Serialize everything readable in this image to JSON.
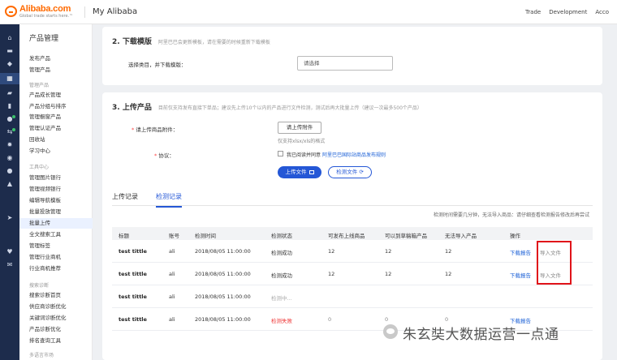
{
  "header": {
    "logo_text": "Alibaba.com",
    "logo_tagline": "Global trade starts here.™",
    "app_title": "My Alibaba",
    "links": [
      "Trade",
      "Development",
      "Acco"
    ]
  },
  "rail": {
    "icons": [
      "home-icon",
      "store-icon",
      "shield-icon",
      "grid-icon",
      "message-icon",
      "chart-icon",
      "users-icon",
      "transfer-icon",
      "gear-icon",
      "target-icon",
      "chat-icon",
      "bank-icon",
      "send-icon",
      "heart-icon",
      "mail-icon"
    ],
    "active_index": 3
  },
  "menu": {
    "title": "产品管理",
    "items": [
      {
        "label": "发布产品",
        "type": "item"
      },
      {
        "label": "管理产品",
        "type": "item"
      },
      {
        "label": "管理产品",
        "type": "group"
      },
      {
        "label": "产品成长管理",
        "type": "item"
      },
      {
        "label": "产品分组与排序",
        "type": "item"
      },
      {
        "label": "管理橱窗产品",
        "type": "item"
      },
      {
        "label": "管理认证产品",
        "type": "item"
      },
      {
        "label": "回收站",
        "type": "item"
      },
      {
        "label": "学习中心",
        "type": "item"
      },
      {
        "label": "工具中心",
        "type": "group"
      },
      {
        "label": "管理图片银行",
        "type": "item"
      },
      {
        "label": "管理视频银行",
        "type": "item"
      },
      {
        "label": "编辑导航模板",
        "type": "item"
      },
      {
        "label": "批量投放管理",
        "type": "item"
      },
      {
        "label": "批量上传",
        "type": "item",
        "active": true
      },
      {
        "label": "全文搜索工具",
        "type": "item"
      },
      {
        "label": "管理标签",
        "type": "item"
      },
      {
        "label": "管理行业商机",
        "type": "item"
      },
      {
        "label": "行业商机推荐",
        "type": "item"
      },
      {
        "label": "搜索诊断",
        "type": "group"
      },
      {
        "label": "搜索诊断首页",
        "type": "item"
      },
      {
        "label": "供应商诊断优化",
        "type": "item"
      },
      {
        "label": "关键词诊断优化",
        "type": "item"
      },
      {
        "label": "产品诊断优化",
        "type": "item"
      },
      {
        "label": "排名查询工具",
        "type": "item"
      },
      {
        "label": "多语言市场",
        "type": "group"
      }
    ]
  },
  "download": {
    "title": "2. 下载模版",
    "hint": "阿里巴巴会更新模板，请在需要的时候重新下载模板",
    "select_label": "选择类目，并下载模版：",
    "select_value": "请选择"
  },
  "upload": {
    "title": "3. 上传产品",
    "hint": "目前仅支持发布直接下单品；建议先上传10个以内的产品进行文件检测，测试后再大批量上传（建议一次最多500个产品）",
    "attach_label": "请上传商品附件：",
    "attach_button": "请上传附件",
    "attach_note": "仅支持xlsx/xls的格式",
    "agree_label": "协议：",
    "agree_text": "我已阅读并同意",
    "agree_link": "阿里巴巴国际站商品发布规则",
    "upload_button": "上传文件",
    "check_button": "检测文件"
  },
  "tabs": [
    {
      "label": "上传记录",
      "active": false
    },
    {
      "label": "检测记录",
      "active": true
    }
  ],
  "tip": "检测时间需要几分钟，无法导入商品：请仔细查看检测报告修改后再尝试",
  "table": {
    "columns": [
      "标题",
      "账号",
      "检测时间",
      "检测状态",
      "可发布上线商品",
      "可以到草稿箱产品",
      "无法导入产品",
      "操作"
    ],
    "rows": [
      {
        "title": "test tittle",
        "account": "ali",
        "time": "2018/08/05 11:00:00",
        "status": "检测成功",
        "status_type": "ok",
        "publishable": "12",
        "draft": "12",
        "failed": "12",
        "report": "下载报告",
        "import": "导入文件"
      },
      {
        "title": "test tittle",
        "account": "ali",
        "time": "2018/08/05 11:00:00",
        "status": "检测成功",
        "status_type": "ok",
        "publishable": "12",
        "draft": "12",
        "failed": "12",
        "report": "下载报告",
        "import": "导入文件"
      },
      {
        "title": "test tittle",
        "account": "ali",
        "time": "2018/08/05 11:00:00",
        "status": "检测中...",
        "status_type": "pending",
        "publishable": "",
        "draft": "",
        "failed": "",
        "report": "",
        "import": ""
      },
      {
        "title": "test tittle",
        "account": "ali",
        "time": "2018/08/05 11:00:00",
        "status": "检测失败",
        "status_type": "fail",
        "publishable": "0",
        "draft": "0",
        "failed": "0",
        "report": "下载报告",
        "import": ""
      }
    ]
  },
  "watermark": "朱玄奘大数据运营一点通",
  "colors": {
    "accent": "#2457d6",
    "brand": "#ff6a00",
    "fail": "#e33333",
    "highlight": "#e0131a",
    "rail": "#1d2c4c"
  }
}
